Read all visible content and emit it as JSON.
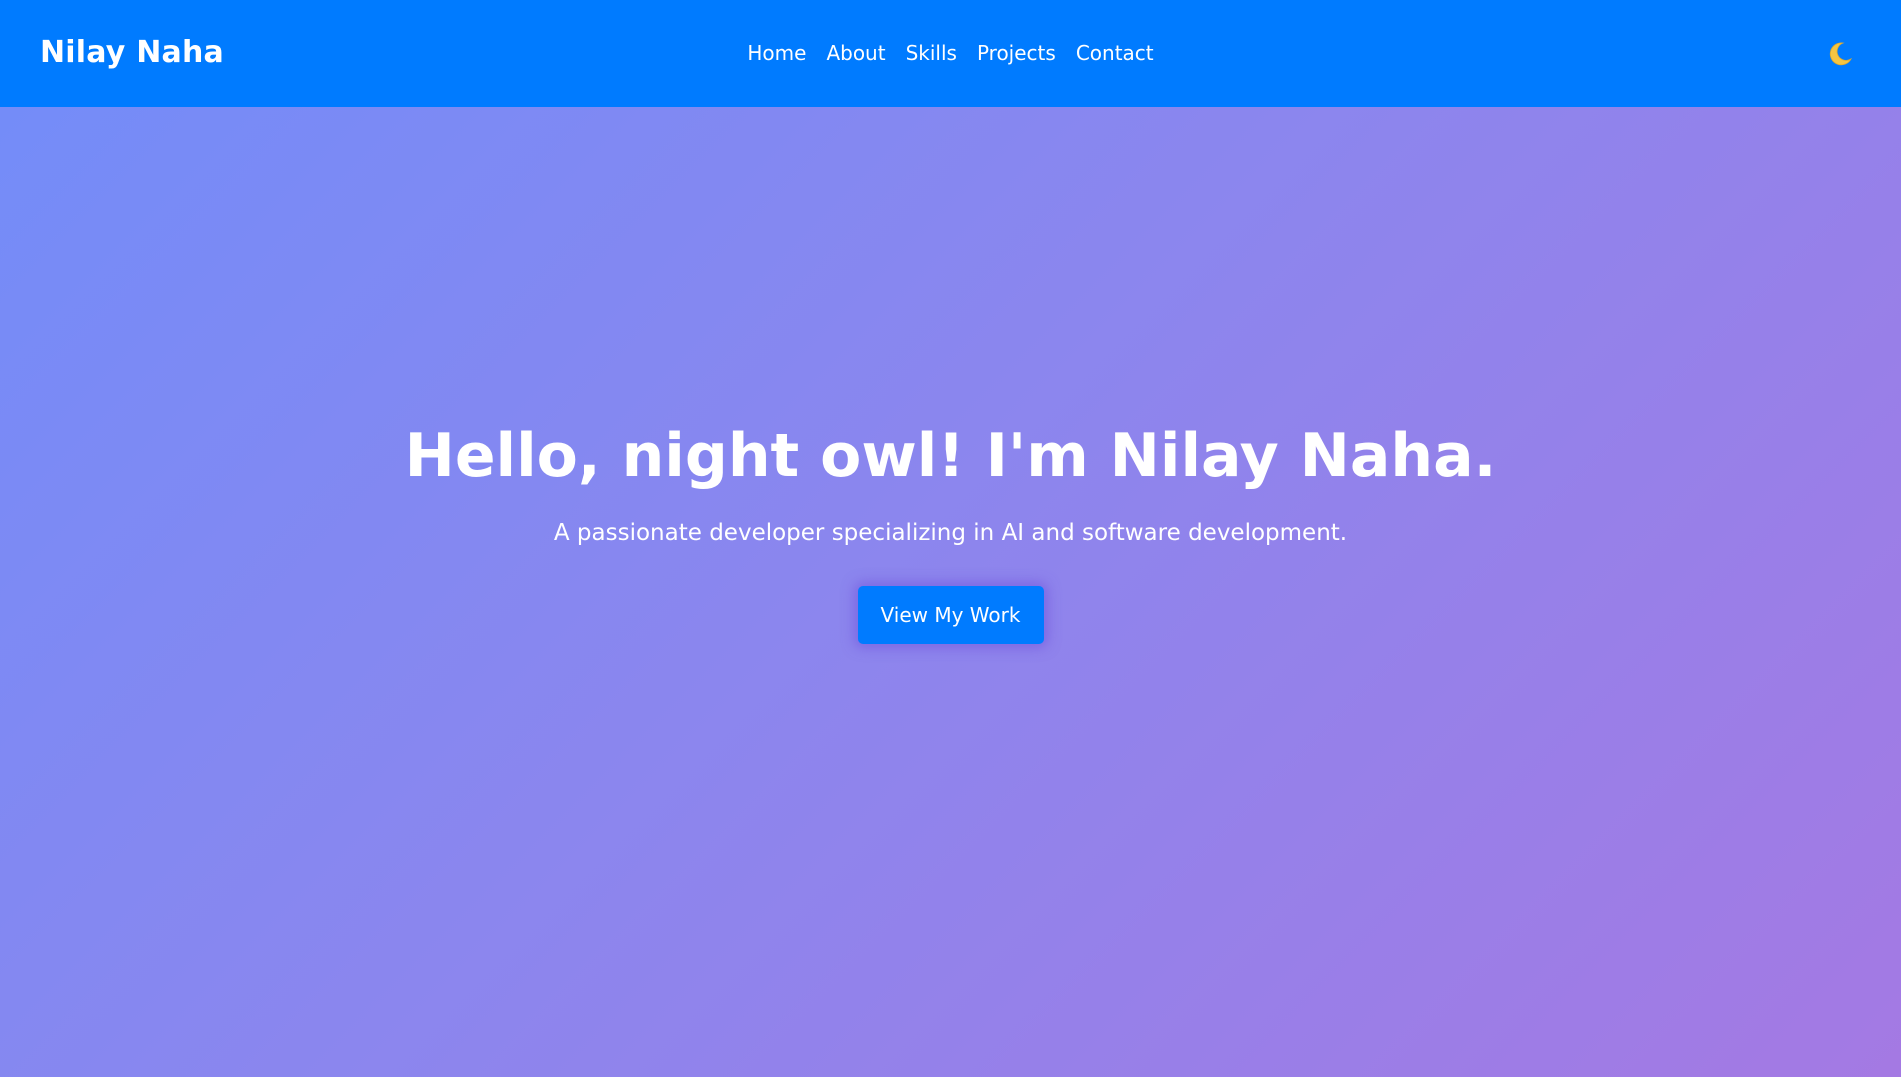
{
  "navbar": {
    "brand": "Nilay Naha",
    "links": [
      "Home",
      "About",
      "Skills",
      "Projects",
      "Contact"
    ],
    "theme_toggle_icon": "moon-icon",
    "background": "#007bff"
  },
  "hero": {
    "title": "Hello, night owl! I'm Nilay Naha.",
    "subtitle": "A passionate developer specializing in AI and software development.",
    "cta_label": "View My Work",
    "gradient_start": "#748cf8",
    "gradient_end": "#a479e3"
  },
  "colors": {
    "accent": "#007bff",
    "moon": "#f5c542"
  }
}
